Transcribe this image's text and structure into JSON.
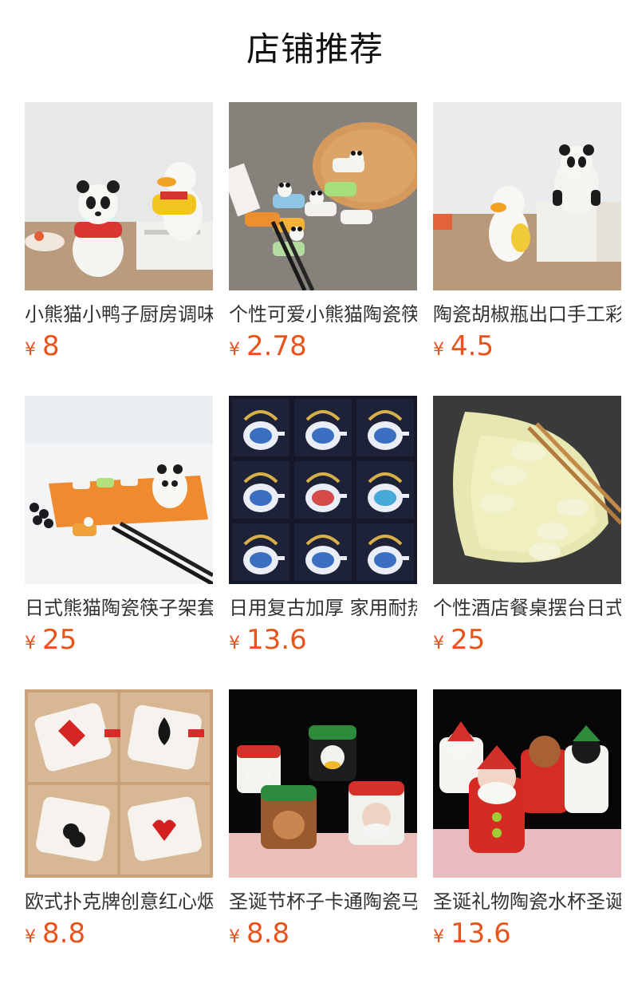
{
  "section": {
    "title": "店铺推荐"
  },
  "products": [
    {
      "title": "小熊猫小鸭子厨房调味罐",
      "currency": "¥",
      "price": "8"
    },
    {
      "title": "个性可爱小熊猫陶瓷筷子架",
      "currency": "¥",
      "price": "2.78"
    },
    {
      "title": "陶瓷胡椒瓶出口手工彩绘",
      "currency": "¥",
      "price": "4.5"
    },
    {
      "title": "日式熊猫陶瓷筷子架套装",
      "currency": "¥",
      "price": "25"
    },
    {
      "title": "日用复古加厚 家用耐热茶壶",
      "currency": "¥",
      "price": "13.6"
    },
    {
      "title": "个性酒店餐桌摆台日式饺子盘",
      "currency": "¥",
      "price": "25"
    },
    {
      "title": "欧式扑克牌创意红心烟灰缸",
      "currency": "¥",
      "price": "8.8"
    },
    {
      "title": "圣诞节杯子卡通陶瓷马克杯",
      "currency": "¥",
      "price": "8.8"
    },
    {
      "title": "圣诞礼物陶瓷水杯圣诞老人",
      "currency": "¥",
      "price": "13.6"
    }
  ],
  "colors": {
    "price": "#e8541b",
    "title_text": "#333333",
    "header_text": "#111111",
    "background": "#ffffff"
  }
}
